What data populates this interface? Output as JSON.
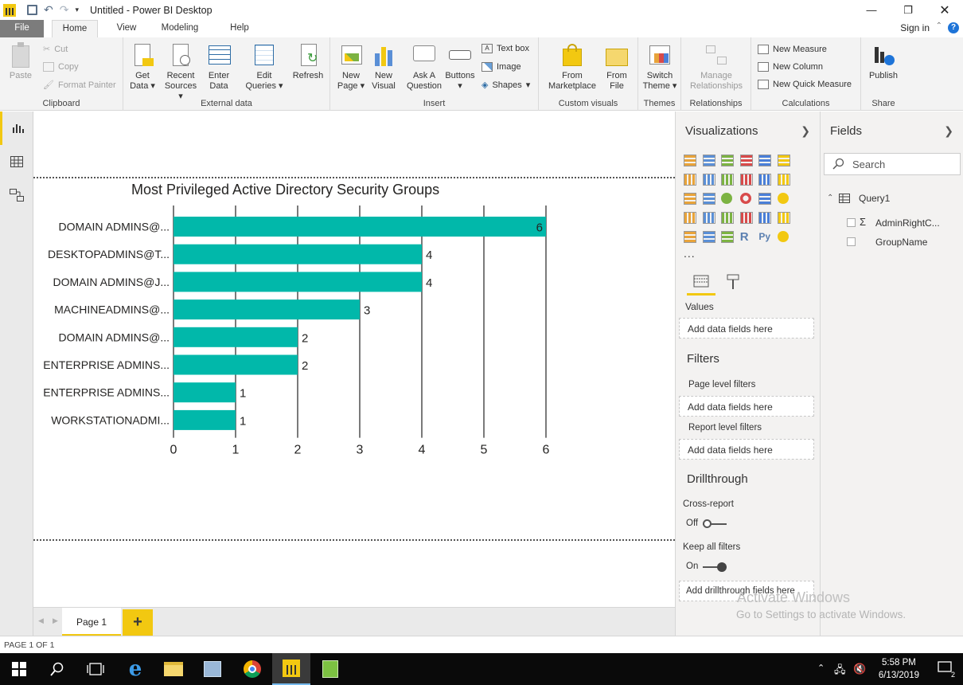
{
  "window": {
    "title": "Untitled - Power BI Desktop",
    "minimize": "—",
    "maximize": "❐",
    "close": "✕"
  },
  "ribbon_tabs": {
    "file": "File",
    "home": "Home",
    "view": "View",
    "modeling": "Modeling",
    "help": "Help",
    "signin": "Sign in"
  },
  "ribbon": {
    "clipboard": {
      "paste": "Paste",
      "cut": "Cut",
      "copy": "Copy",
      "format_painter": "Format Painter",
      "label": "Clipboard"
    },
    "external": {
      "get": "Get",
      "data": "Data",
      "recent": "Recent",
      "sources": "Sources",
      "enter": "Enter",
      "enter_data": "Data",
      "edit": "Edit",
      "queries": "Queries",
      "refresh": "Refresh",
      "label": "External data"
    },
    "insert": {
      "new": "New",
      "page": "Page",
      "new2": "New",
      "visual": "Visual",
      "ask": "Ask A",
      "question": "Question",
      "buttons": "Buttons",
      "text_box": "Text box",
      "image": "Image",
      "shapes": "Shapes",
      "label": "Insert"
    },
    "custom": {
      "from": "From",
      "marketplace": "Marketplace",
      "from2": "From",
      "file": "File",
      "label": "Custom visuals"
    },
    "themes": {
      "switch": "Switch",
      "theme": "Theme",
      "label": "Themes"
    },
    "relationships": {
      "manage": "Manage",
      "rels": "Relationships",
      "label": "Relationships"
    },
    "calculations": {
      "new_measure": "New Measure",
      "new_column": "New Column",
      "new_quick_measure": "New Quick Measure",
      "label": "Calculations"
    },
    "share": {
      "publish": "Publish",
      "label": "Share"
    }
  },
  "chart_data": {
    "type": "bar",
    "orientation": "horizontal",
    "title": "Most Privileged Active Directory Security Groups",
    "categories": [
      "DOMAIN ADMINS@...",
      "DESKTOPADMINS@T...",
      "DOMAIN ADMINS@J...",
      "MACHINEADMINS@...",
      "DOMAIN ADMINS@...",
      "ENTERPRISE ADMINS...",
      "ENTERPRISE ADMINS...",
      "WORKSTATIONADMI..."
    ],
    "values": [
      6,
      4,
      4,
      3,
      2,
      2,
      1,
      1
    ],
    "xlim": [
      0,
      6
    ],
    "xticks": [
      "0",
      "1",
      "2",
      "3",
      "4",
      "5",
      "6"
    ],
    "data_labels": true,
    "grid": true,
    "color": "#01b8aa"
  },
  "pages": {
    "page1": "Page 1",
    "add": "+"
  },
  "status": "PAGE 1 OF 1",
  "viz_pane": {
    "title": "Visualizations",
    "more": "...",
    "values_label": "Values",
    "add_fields": "Add data fields here",
    "filters_title": "Filters",
    "page_level": "Page level filters",
    "page_add": "Add data fields here",
    "report_level": "Report level filters",
    "report_add": "Add data fields here",
    "drill_title": "Drillthrough",
    "cross_report": "Cross-report",
    "off": "Off",
    "keep_all": "Keep all filters",
    "on": "On",
    "drill_add": "Add drillthrough fields here"
  },
  "fields_pane": {
    "title": "Fields",
    "search_placeholder": "Search",
    "table": "Query1",
    "field1": "AdminRightC...",
    "field2": "GroupName"
  },
  "watermark": {
    "line1": "Activate Windows",
    "line2": "Go to Settings to activate Windows."
  },
  "taskbar": {
    "time": "5:58 PM",
    "date": "6/13/2019",
    "notif_count": "2"
  },
  "colors": {
    "accent": "#f2c811",
    "bar": "#01b8aa",
    "file_tab": "#7c7c7c"
  }
}
